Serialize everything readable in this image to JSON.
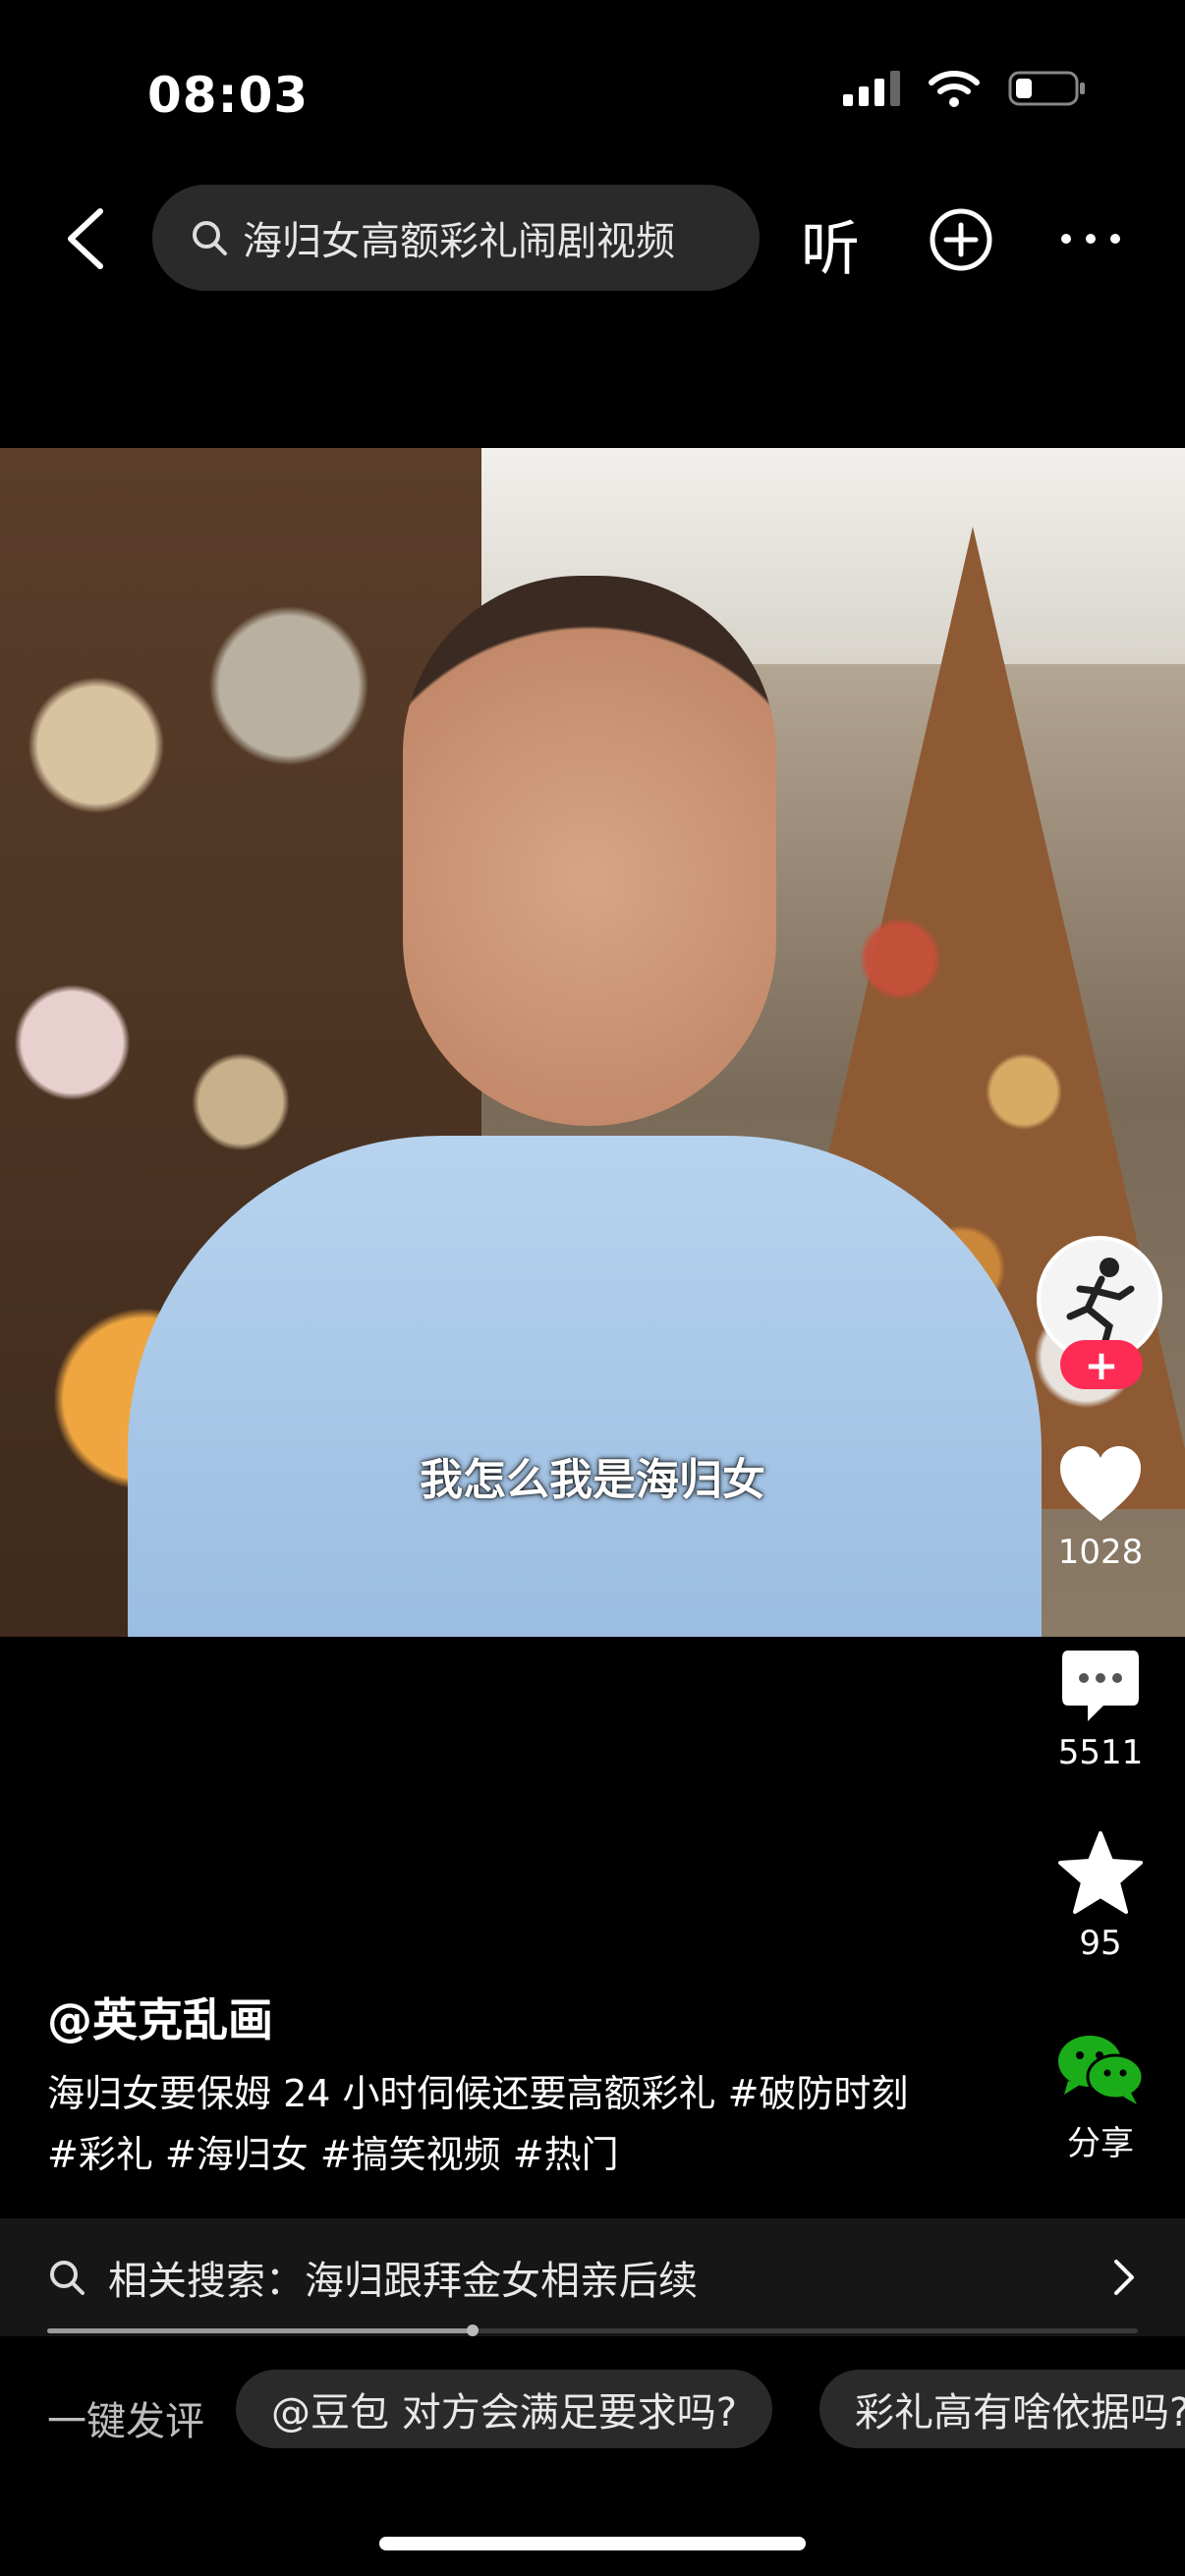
{
  "status_bar": {
    "time": "08:03"
  },
  "header": {
    "search_text": "海归女高额彩礼闹剧视频",
    "listen_label": "听"
  },
  "video": {
    "subtitle": "我怎么我是海归女"
  },
  "actions": {
    "likes": "1028",
    "comments": "5511",
    "favorites": "95",
    "share_label": "分享",
    "follow_label": "+"
  },
  "caption": {
    "author": "@英克乱画",
    "line1": "海归女要保姆 24 小时伺候还要高额彩礼 #破防时刻",
    "line2": "#彩礼 #海归女 #搞笑视频 #热门"
  },
  "related_search": {
    "label": "相关搜索：海归跟拜金女相亲后续"
  },
  "playback": {
    "progress": 0.39
  },
  "quick_comment": {
    "label": "一键发评",
    "chips": [
      "@豆包 对方会满足要求吗?",
      "彩礼高有啥依据吗?"
    ]
  },
  "colors": {
    "accent": "#fe2c55",
    "share_green": "#1aad19"
  }
}
